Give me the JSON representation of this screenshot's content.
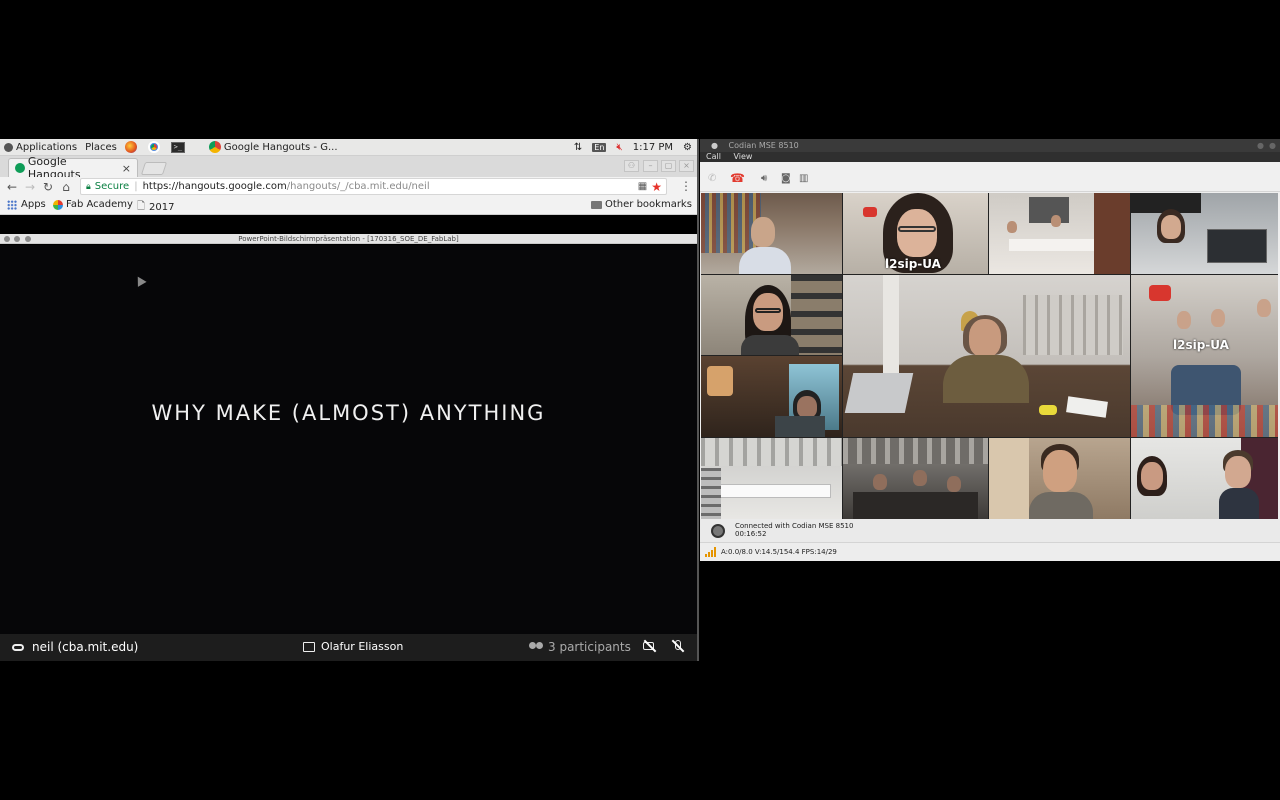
{
  "gnome_panel": {
    "applications": "Applications",
    "places": "Places",
    "chrome_task": "Google Hangouts - G...",
    "lang": "En",
    "clock": "1:17 PM"
  },
  "browser": {
    "tab_title": "Google Hangouts",
    "tab_close": "×",
    "secure_label": "Secure",
    "url_host": "https://hangouts.google.com",
    "url_path": "/hangouts/_/cba.mit.edu/neil",
    "bookmarks": {
      "apps": "Apps",
      "fab_academy": "Fab Academy",
      "year": "2017",
      "other": "Other bookmarks"
    }
  },
  "presentation": {
    "window_title": "PowerPoint-Bildschirmpräsentation - [170316_SOE_DE_FabLab]",
    "slide_title": "WHY MAKE (ALMOST) ANYTHING"
  },
  "hangout_bar": {
    "host": "neil (cba.mit.edu)",
    "presenter": "Olafur Eliasson",
    "participants": "3 participants"
  },
  "codian": {
    "window_title": "Codian MSE 8510",
    "menu": [
      "Call",
      "View"
    ],
    "tile_labels": [
      "l2sip-UA",
      "l2sip-UA"
    ],
    "status_line1": "Connected with Codian MSE 8510",
    "status_line2": "00:16:52",
    "stats": "A:0.0/8.0 V:14.5/154.4 FPS:14/29",
    "colors": {
      "hangup": "#e23a2f",
      "signal": "#e59400"
    }
  }
}
